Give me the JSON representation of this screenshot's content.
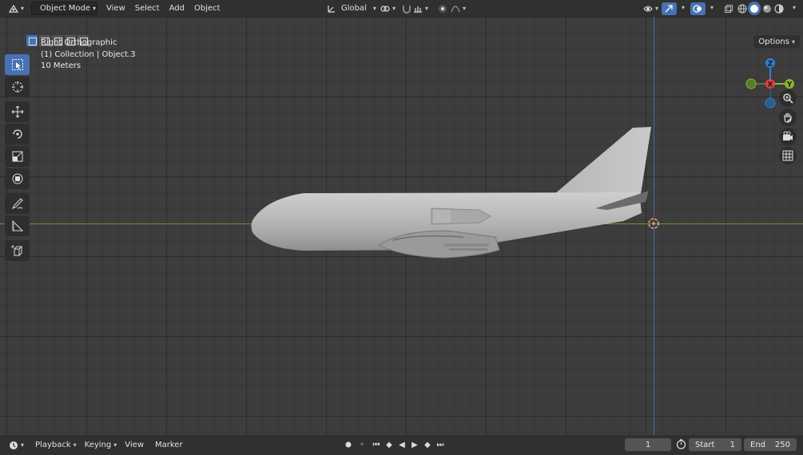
{
  "header": {
    "mode_label": "Object Mode",
    "menu": [
      "View",
      "Select",
      "Add",
      "Object"
    ],
    "transform_orientation": "Global"
  },
  "viewport": {
    "view_name": "Right Orthographic",
    "collection_info": "(1) Collection | Object.3",
    "scale_info": "10 Meters",
    "options_label": "Options"
  },
  "gizmo": {
    "z": "Z",
    "x": "X",
    "y": "Y"
  },
  "colors": {
    "accent": "#4772b3",
    "axis_x": "#e53c4a",
    "axis_y": "#8bb32d",
    "axis_z": "#2e7fd8",
    "header": "#303030",
    "viewport": "#3d3d3d"
  },
  "timeline": {
    "menu": [
      "Playback",
      "Keying",
      "View",
      "Marker"
    ],
    "current_frame": "1",
    "start_label": "Start",
    "start_value": "1",
    "end_label": "End",
    "end_value": "250"
  }
}
